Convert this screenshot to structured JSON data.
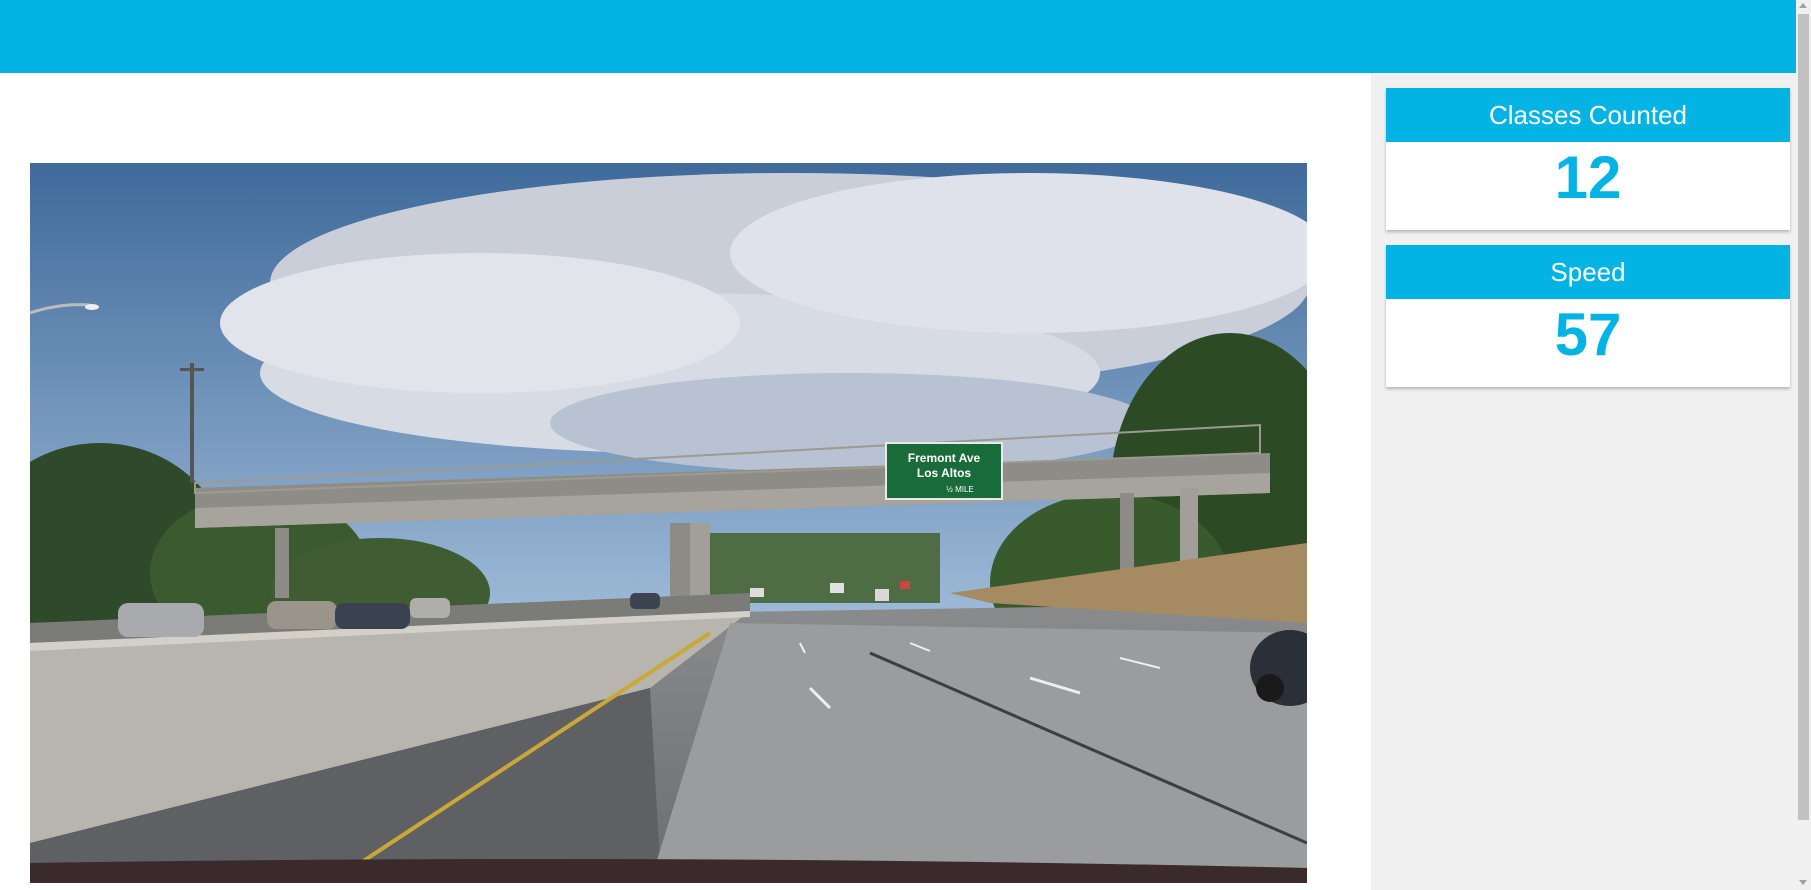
{
  "header": {
    "color": "#03b3e3"
  },
  "video": {
    "scene": "dashcam-highway-overpass",
    "sign_line1": "Fremont Ave",
    "sign_line2": "Los Altos",
    "sign_line3": "½ MILE"
  },
  "stats": {
    "classes_label": "Classes Counted",
    "classes_value": "12",
    "speed_label": "Speed",
    "speed_value": "57"
  },
  "colors": {
    "accent": "#03b3e3",
    "sidebar_bg": "#f0f0f0"
  }
}
